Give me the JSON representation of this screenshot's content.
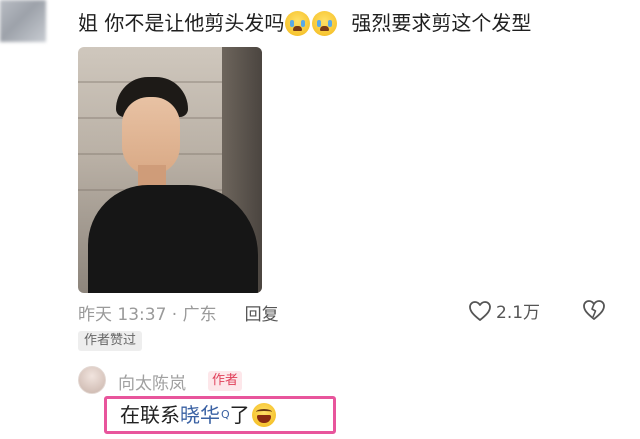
{
  "comment": {
    "text_part1": "姐 你不是让他剪头发吗",
    "text_part2": "强烈要求剪这个发型",
    "emoji": "crying-face",
    "time_location": "昨天 13:37 · 广东",
    "reply_label": "回复",
    "like_count": "2.1万",
    "author_liked": "作者赞过"
  },
  "reply": {
    "user_name": "向太陈岚",
    "author_badge": "作者",
    "text_before": "在联系",
    "link_text": "晓华",
    "search_mark": "Q",
    "text_after": "了",
    "emoji": "laughing-face"
  },
  "colors": {
    "highlight_border": "#e8559c",
    "link": "#3a61a3",
    "author_badge": "#e0405a"
  }
}
